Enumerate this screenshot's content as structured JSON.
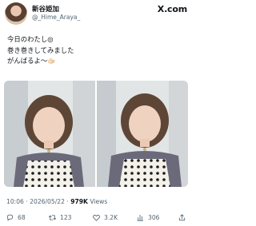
{
  "author": {
    "display_name": "新谷姫加",
    "handle": "@_Hime_Araya_"
  },
  "brand": "X.com",
  "tweet": {
    "lines": [
      "今日のわたし◎",
      "巻き巻きしてみました",
      "がんばるよ〜🫱🏻"
    ]
  },
  "media": {
    "photo_count": 2
  },
  "meta": {
    "time": "10:06",
    "separator": "·",
    "date": "2026/05/22",
    "views_count": "979K",
    "views_label": "Views"
  },
  "actions": {
    "replies": "68",
    "reposts": "123",
    "likes": "3.2K",
    "views": "306"
  },
  "icons": {
    "reply": "reply-icon",
    "repost": "repost-icon",
    "like": "heart-icon",
    "views": "bar-chart-icon",
    "share": "share-icon"
  },
  "colors": {
    "text": "#0f1419",
    "secondary": "#536471"
  }
}
